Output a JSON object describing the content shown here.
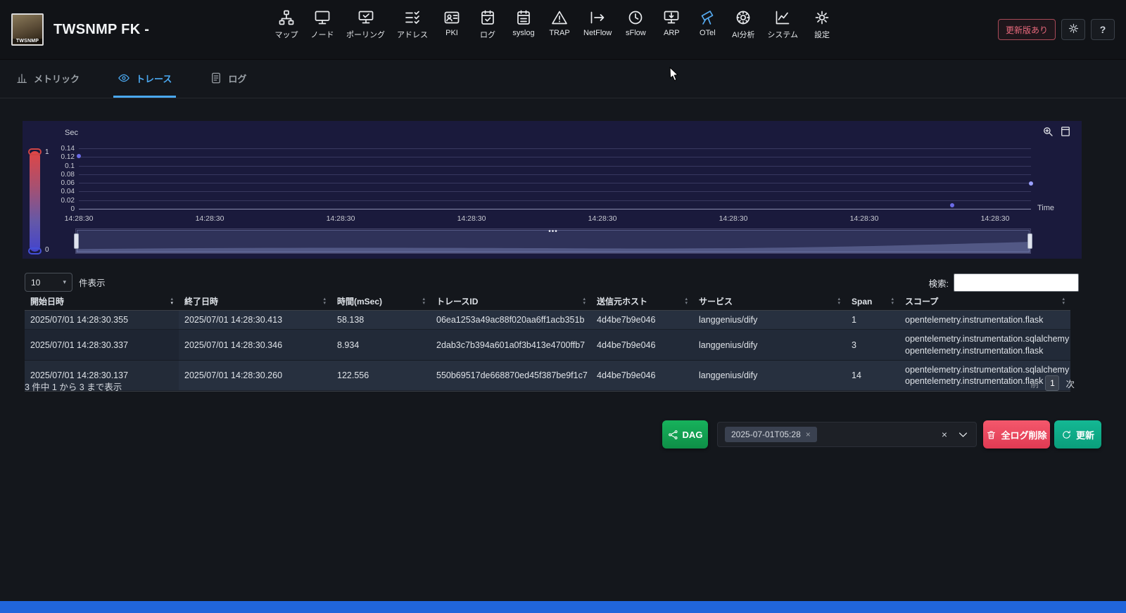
{
  "app": {
    "title": "TWSNMP FK -",
    "logo_text": "TWSNMP"
  },
  "header": {
    "nav": [
      {
        "id": "map",
        "label": "マップ"
      },
      {
        "id": "node",
        "label": "ノード"
      },
      {
        "id": "polling",
        "label": "ポーリング"
      },
      {
        "id": "address",
        "label": "アドレス"
      },
      {
        "id": "pki",
        "label": "PKI"
      },
      {
        "id": "log",
        "label": "ログ"
      },
      {
        "id": "syslog",
        "label": "syslog"
      },
      {
        "id": "trap",
        "label": "TRAP"
      },
      {
        "id": "netflow",
        "label": "NetFlow"
      },
      {
        "id": "sflow",
        "label": "sFlow"
      },
      {
        "id": "arp",
        "label": "ARP"
      },
      {
        "id": "otel",
        "label": "OTel",
        "accent": "#55aaf0"
      },
      {
        "id": "ai",
        "label": "AI分析"
      },
      {
        "id": "system",
        "label": "システム"
      },
      {
        "id": "settings",
        "label": "設定"
      }
    ],
    "update_button_label": "更新版あり",
    "help_label": "?"
  },
  "tabs": [
    {
      "id": "metrics",
      "icon": "metric",
      "label": "メトリック",
      "active": false
    },
    {
      "id": "traces",
      "icon": "eye",
      "label": "トレース",
      "active": true
    },
    {
      "id": "logs",
      "icon": "doc",
      "label": "ログ",
      "active": false
    }
  ],
  "chart_data": {
    "type": "scatter",
    "ylabel": "Sec",
    "xlabel": "Time",
    "ylim": [
      0,
      0.14
    ],
    "y_ticks": [
      "0",
      "0.02",
      "0.04",
      "0.06",
      "0.08",
      "0.1",
      "0.12",
      "0.14"
    ],
    "x_tick_labels": [
      "14:28:30",
      "14:28:30",
      "14:28:30",
      "14:28:30",
      "14:28:30",
      "14:28:30",
      "14:28:30",
      "14:28:30"
    ],
    "visual_map": {
      "max_label": "1",
      "min_label": "0",
      "top_color": "#e04646",
      "bottom_color": "#4444cc"
    },
    "points": [
      {
        "start": "2025/07/01 14:28:30.137",
        "sec": 0.122556,
        "x_frac": 0.0,
        "color": "#6b6be6"
      },
      {
        "start": "2025/07/01 14:28:30.337",
        "sec": 0.008934,
        "x_frac": 0.917,
        "color": "#6b6be6"
      },
      {
        "start": "2025/07/01 14:28:30.355",
        "sec": 0.058138,
        "x_frac": 1.0,
        "color": "#9aa0ff"
      }
    ]
  },
  "table_controls": {
    "page_size": "10",
    "length_label": "件表示",
    "search_label": "検索:",
    "search_value": ""
  },
  "table": {
    "columns": [
      {
        "key": "start",
        "label": "開始日時",
        "sort": "desc"
      },
      {
        "key": "end",
        "label": "終了日時",
        "sort": null
      },
      {
        "key": "duration",
        "label": "時間(mSec)",
        "sort": null
      },
      {
        "key": "trace_id",
        "label": "トレースID",
        "sort": null
      },
      {
        "key": "host",
        "label": "送信元ホスト",
        "sort": null
      },
      {
        "key": "service",
        "label": "サービス",
        "sort": null
      },
      {
        "key": "span",
        "label": "Span",
        "sort": null
      },
      {
        "key": "scope",
        "label": "スコープ",
        "sort": null
      }
    ],
    "rows": [
      {
        "start": "2025/07/01 14:28:30.355",
        "end": "2025/07/01 14:28:30.413",
        "duration": "58.138",
        "trace_id": "06ea1253a49ac88f020aa6ff1acb351b",
        "host": "4d4be7b9e046",
        "service": "langgenius/dify",
        "span": "1",
        "scope": [
          "opentelemetry.instrumentation.flask"
        ]
      },
      {
        "start": "2025/07/01 14:28:30.337",
        "end": "2025/07/01 14:28:30.346",
        "duration": "8.934",
        "trace_id": "2dab3c7b394a601a0f3b413e4700ffb7",
        "host": "4d4be7b9e046",
        "service": "langgenius/dify",
        "span": "3",
        "scope": [
          "opentelemetry.instrumentation.sqlalchemy",
          "opentelemetry.instrumentation.flask"
        ]
      },
      {
        "start": "2025/07/01 14:28:30.137",
        "end": "2025/07/01 14:28:30.260",
        "duration": "122.556",
        "trace_id": "550b69517de668870ed45f387be9f1c7",
        "host": "4d4be7b9e046",
        "service": "langgenius/dify",
        "span": "14",
        "scope": [
          "opentelemetry.instrumentation.sqlalchemy",
          "opentelemetry.instrumentation.flask"
        ]
      }
    ],
    "info": "3 件中 1 から 3 まで表示",
    "pagination": {
      "prev": "前",
      "current": "1",
      "next": "次"
    }
  },
  "actions": {
    "dag_label": "DAG",
    "filter_chip": "2025-07-01T05:28",
    "delete_label": "全ログ削除",
    "refresh_label": "更新"
  }
}
